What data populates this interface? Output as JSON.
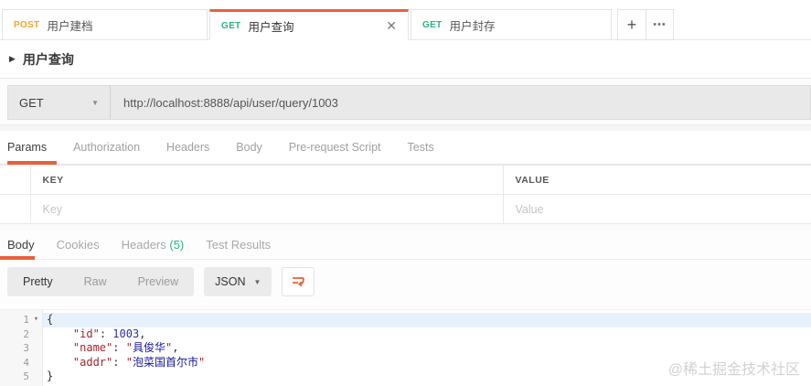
{
  "colors": {
    "accent": "#e8613c",
    "post-color": "#f0a52b",
    "get-color": "#2ab57d",
    "key-color": "#a1262d",
    "num-color": "#2e2ea6",
    "str-color": "#16169c"
  },
  "icons": {
    "close": "✕",
    "plus": "+",
    "more": "•••",
    "caret_down": "▼",
    "caret_right": "▶",
    "fold": "▾"
  },
  "tabs": {
    "items": [
      {
        "method": "POST",
        "title": "用户建档"
      },
      {
        "method": "GET",
        "title": "用户查询"
      },
      {
        "method": "GET",
        "title": "用户封存"
      }
    ]
  },
  "request": {
    "name": "用户查询",
    "method": "GET",
    "url": "http://localhost:8888/api/user/query/1003",
    "tabs": [
      "Params",
      "Authorization",
      "Headers",
      "Body",
      "Pre-request Script",
      "Tests"
    ],
    "active_tab": "Params"
  },
  "params_table": {
    "key_header": "KEY",
    "value_header": "VALUE",
    "key_placeholder": "Key",
    "value_placeholder": "Value"
  },
  "response": {
    "tabs": {
      "body": "Body",
      "cookies": "Cookies",
      "headers": "Headers",
      "headers_badge": "(5)",
      "tests": "Test Results"
    },
    "modes": [
      "Pretty",
      "Raw",
      "Preview"
    ],
    "active_mode": "Pretty",
    "format": "JSON",
    "code_lines": [
      {
        "num": "1",
        "brace": "{"
      },
      {
        "num": "2",
        "indent": "    ",
        "key": "\"id\"",
        "colon": ": ",
        "number": "1003",
        "comma": ","
      },
      {
        "num": "3",
        "indent": "    ",
        "key": "\"name\"",
        "colon": ": ",
        "q1": "\"",
        "str": "具俊华",
        "q2": "\"",
        "comma": ","
      },
      {
        "num": "4",
        "indent": "    ",
        "key": "\"addr\"",
        "colon": ": ",
        "q1": "\"",
        "str": "泡菜国首尔市",
        "q2": "\""
      },
      {
        "num": "5",
        "brace": "}"
      }
    ]
  },
  "watermark": "@稀土掘金技术社区"
}
